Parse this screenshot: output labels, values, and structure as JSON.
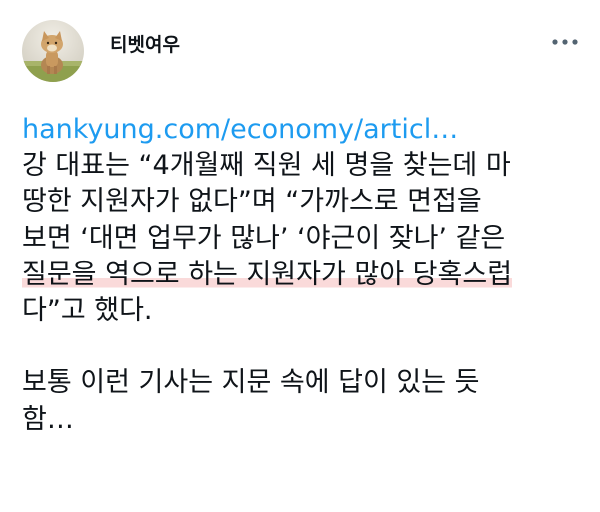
{
  "tweet": {
    "author": {
      "display_name": "티벳여우",
      "avatar_icon": "tibetan-fox-avatar"
    },
    "more_icon": "more-horizontal-icon",
    "link_text": "hankyung.com/economy/articl…",
    "body_lines": [
      "강 대표는 “4개월째 직원 세 명을 찾는데 마",
      "땅한 지원자가 없다”며 “가까스로 면접을",
      "보면 ‘대면 업무가 많나’ ‘야근이 잦나’ 같은",
      "질문을 역으로 하는 지원자가 많아 당혹스럽",
      "다”고 했다."
    ],
    "comment_lines": [
      "보통 이런 기사는 지문 속에 답이 있는 듯",
      "함…"
    ],
    "colors": {
      "link": "#1d9bf0",
      "text": "#0f1419",
      "highlight": "#fadada"
    }
  }
}
